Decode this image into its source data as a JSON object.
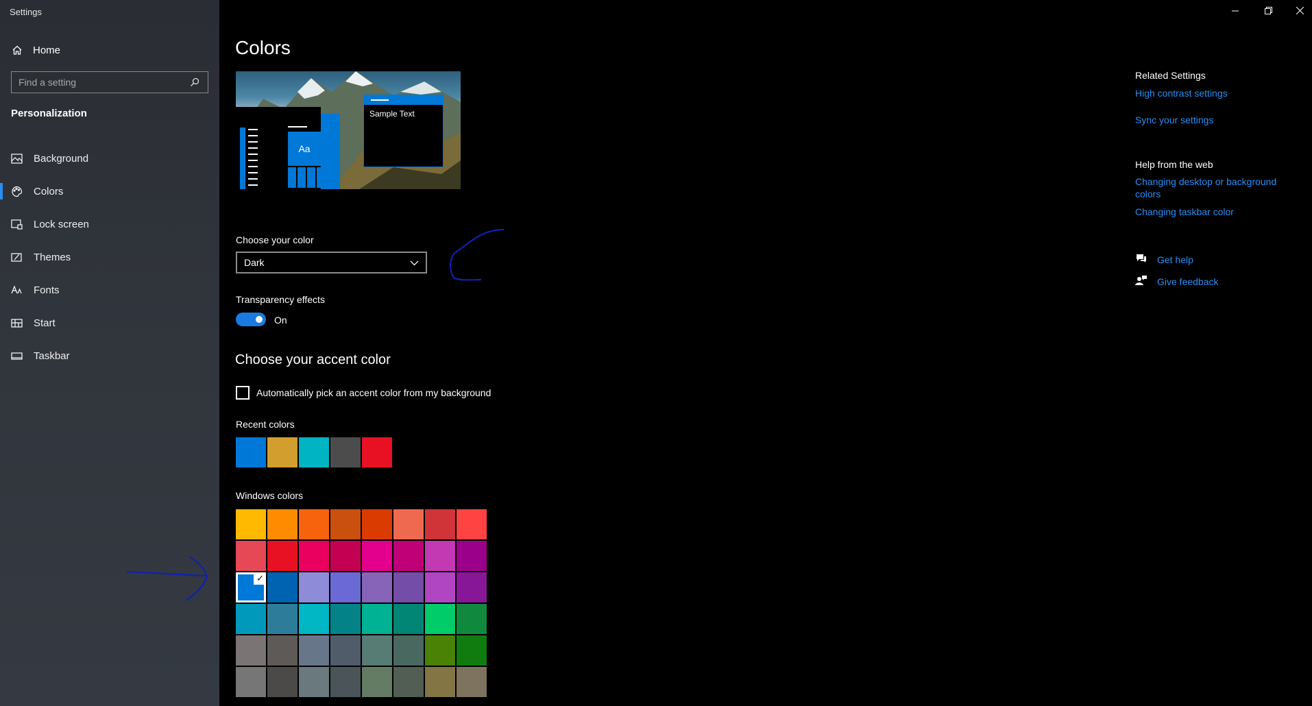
{
  "window": {
    "title": "Settings"
  },
  "sidebar": {
    "home_label": "Home",
    "search_placeholder": "Find a setting",
    "section": "Personalization",
    "items": [
      {
        "label": "Background",
        "icon": "image-icon",
        "active": false
      },
      {
        "label": "Colors",
        "icon": "palette-icon",
        "active": true
      },
      {
        "label": "Lock screen",
        "icon": "lock-screen-icon",
        "active": false
      },
      {
        "label": "Themes",
        "icon": "themes-icon",
        "active": false
      },
      {
        "label": "Fonts",
        "icon": "fonts-icon",
        "active": false
      },
      {
        "label": "Start",
        "icon": "start-icon",
        "active": false
      },
      {
        "label": "Taskbar",
        "icon": "taskbar-icon",
        "active": false
      }
    ]
  },
  "main": {
    "title": "Colors",
    "preview": {
      "tile_text": "Aa",
      "sample_text": "Sample Text"
    },
    "choose_color": {
      "label": "Choose your color",
      "value": "Dark"
    },
    "transparency": {
      "label": "Transparency effects",
      "state": "On"
    },
    "accent_heading": "Choose your accent color",
    "auto_pick_label": "Automatically pick an accent color from my background",
    "recent_label": "Recent colors",
    "recent_colors": [
      "#0078d7",
      "#d29e2e",
      "#00b4c3",
      "#4c4c4c",
      "#e81123"
    ],
    "windows_label": "Windows colors",
    "windows_colors": [
      "#ffb900",
      "#ff8c00",
      "#f7630c",
      "#ca5010",
      "#da3b01",
      "#ef6950",
      "#d13438",
      "#ff4343",
      "#e74856",
      "#e81123",
      "#ea005e",
      "#c30052",
      "#e3008c",
      "#bf0077",
      "#c239b3",
      "#9a0089",
      "#0078d7",
      "#0063b1",
      "#8e8cd8",
      "#6b69d6",
      "#8764b8",
      "#744da9",
      "#b146c2",
      "#881798",
      "#0099bc",
      "#2d7d9a",
      "#00b7c3",
      "#038387",
      "#00b294",
      "#018574",
      "#00cc6a",
      "#10893e",
      "#7a7574",
      "#5d5a58",
      "#68768a",
      "#515c6b",
      "#567c73",
      "#486860",
      "#498205",
      "#107c10",
      "#767676",
      "#4c4a48",
      "#69797e",
      "#4a5459",
      "#647c64",
      "#525e54",
      "#847545",
      "#7e735f"
    ],
    "selected_color_index": 16
  },
  "right": {
    "related_heading": "Related Settings",
    "related_links": [
      "High contrast settings",
      "Sync your settings"
    ],
    "help_heading": "Help from the web",
    "help_links": [
      "Changing desktop or background colors",
      "Changing taskbar color"
    ],
    "get_help": "Get help",
    "give_feedback": "Give feedback"
  },
  "colors": {
    "accent": "#0078d7",
    "link": "#2a8ef5",
    "sidebar_bg": "#30343b",
    "main_bg": "#000000"
  }
}
